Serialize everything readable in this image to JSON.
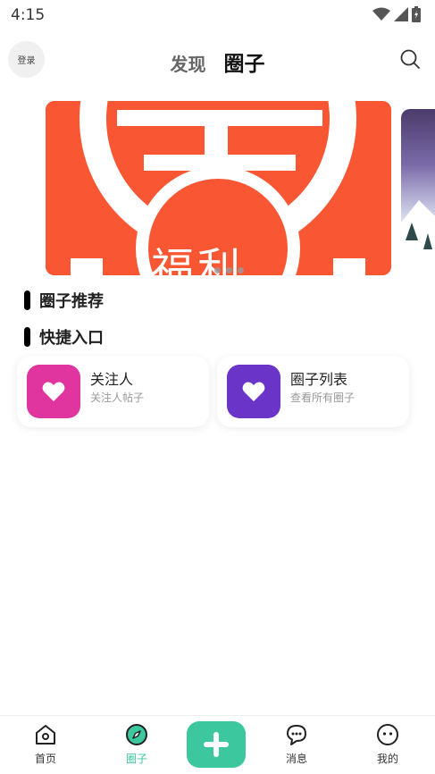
{
  "status": {
    "time": "4:15"
  },
  "header": {
    "login_label": "登录",
    "tabs": [
      {
        "label": "发现"
      },
      {
        "label": "圈子"
      }
    ]
  },
  "banner": {
    "text": "福利",
    "big_glyph": "王",
    "color": "#f95733"
  },
  "sections": {
    "recommend": "圈子推荐",
    "quick": "快捷入口"
  },
  "quick_entries": [
    {
      "title": "关注人",
      "subtitle": "关注人帖子",
      "icon": "heart-icon",
      "color": "#e0359f"
    },
    {
      "title": "圈子列表",
      "subtitle": "查看所有圈子",
      "icon": "heart-icon",
      "color": "#6b34c9"
    }
  ],
  "bottom_nav": {
    "items": [
      {
        "label": "首页",
        "icon": "home-icon"
      },
      {
        "label": "圈子",
        "icon": "compass-icon"
      },
      {
        "label": "消息",
        "icon": "chat-icon"
      },
      {
        "label": "我的",
        "icon": "face-icon"
      }
    ],
    "accent": "#3cc79e"
  }
}
